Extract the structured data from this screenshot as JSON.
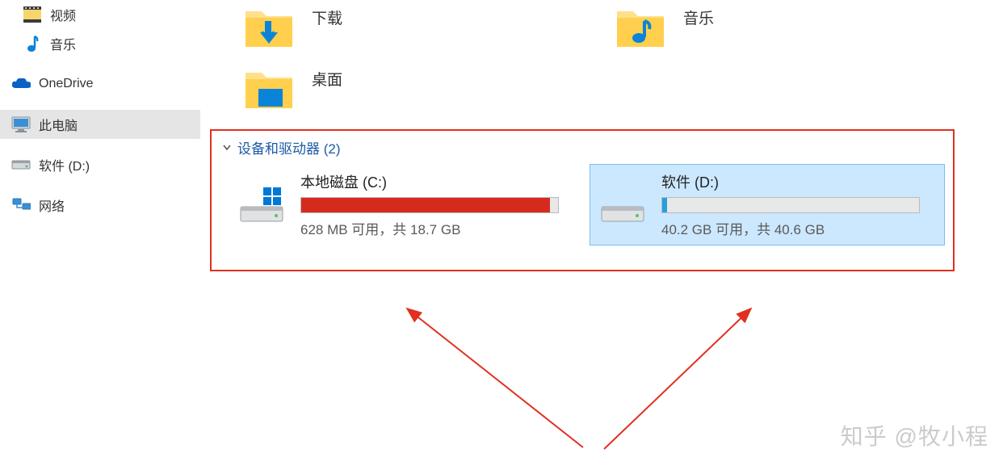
{
  "sidebar": {
    "items": [
      {
        "label": "视频"
      },
      {
        "label": "音乐"
      },
      {
        "label": "OneDrive"
      },
      {
        "label": "此电脑"
      },
      {
        "label": "软件 (D:)"
      },
      {
        "label": "网络"
      }
    ]
  },
  "folders": [
    {
      "label": "下载"
    },
    {
      "label": "音乐"
    },
    {
      "label": "桌面"
    }
  ],
  "section": {
    "title": "设备和驱动器 (2)"
  },
  "drives": [
    {
      "title": "本地磁盘 (C:)",
      "status": "628 MB 可用，共 18.7 GB",
      "fillPercent": 97,
      "fillColor": "red",
      "selected": false,
      "hasWinLogo": true
    },
    {
      "title": "软件 (D:)",
      "status": "40.2 GB 可用，共 40.6 GB",
      "fillPercent": 2,
      "fillColor": "blue",
      "selected": true,
      "hasWinLogo": false
    }
  ],
  "watermark": "知乎 @牧小程"
}
